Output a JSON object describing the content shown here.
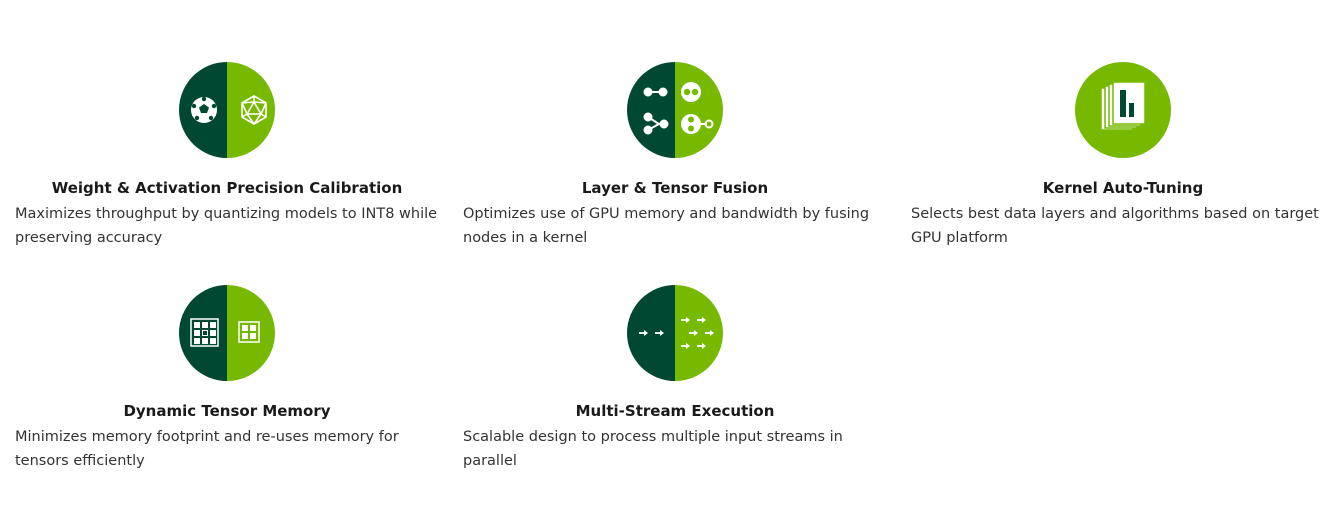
{
  "colors": {
    "dark_green": "#004831",
    "light_green": "#76b900",
    "text_dark": "#1a1a1a",
    "text_body": "#333333"
  },
  "features": [
    {
      "icon": "precision-calibration-icon",
      "title": "Weight & Activation Precision Calibration",
      "description": "Maximizes throughput by quantizing models to INT8 while preserving accuracy"
    },
    {
      "icon": "tensor-fusion-icon",
      "title": "Layer & Tensor Fusion",
      "description": "Optimizes use of GPU memory and bandwidth by fusing nodes in a kernel"
    },
    {
      "icon": "kernel-tuning-icon",
      "title": "Kernel Auto-Tuning",
      "description": "Selects best data layers and algorithms based on target GPU platform"
    },
    {
      "icon": "tensor-memory-icon",
      "title": "Dynamic Tensor Memory",
      "description": "Minimizes memory footprint and re-uses memory for tensors efficiently"
    },
    {
      "icon": "multi-stream-icon",
      "title": "Multi-Stream Execution",
      "description": "Scalable design to process multiple input streams in parallel"
    }
  ]
}
